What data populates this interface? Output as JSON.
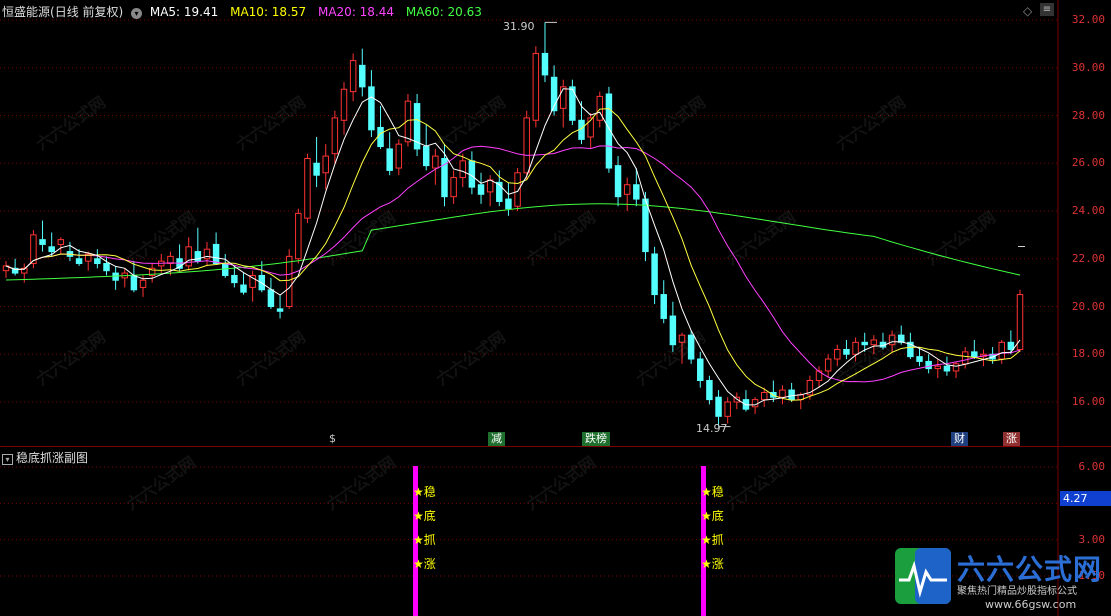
{
  "header": {
    "stock_name": "恒盛能源",
    "period": "(日线 前复权)",
    "ma5": "MA5: 19.41",
    "ma10": "MA10: 18.57",
    "ma20": "MA20: 18.44",
    "ma60": "MA60: 20.63"
  },
  "colors": {
    "up": "#ff3333",
    "down": "#54ffff",
    "ma5": "#ffffff",
    "ma10": "#ffff40",
    "ma20": "#ff40ff",
    "ma60": "#40ff40",
    "grid": "#7a0000",
    "signal_bar": "#ff00ff"
  },
  "price_axis": [
    "32.00",
    "30.00",
    "28.00",
    "26.00",
    "24.00",
    "22.00",
    "20.00",
    "18.00",
    "16.00"
  ],
  "annotations": {
    "high": "31.90",
    "low": "14.97",
    "current_marker": ""
  },
  "event_tags": [
    {
      "label": "$",
      "color": "#ff3333",
      "bg": "transparent"
    },
    {
      "label": "减",
      "color": "#ffffff",
      "bg": "#1f6f2f"
    },
    {
      "label": "跌榜",
      "color": "#ffffff",
      "bg": "#1f6f2f"
    },
    {
      "label": "财",
      "color": "#ffffff",
      "bg": "#1f3f7f"
    },
    {
      "label": "涨",
      "color": "#ffffff",
      "bg": "#8f2f2f"
    }
  ],
  "sub_panel": {
    "title": "稳底抓涨副图",
    "axis": [
      "6.00",
      "4.50",
      "3.00",
      "1.50"
    ],
    "current_value": "4.27",
    "signal_lines": [
      "★稳",
      "★底",
      "★抓",
      "★涨"
    ]
  },
  "watermark": {
    "brand": "六六公式网",
    "slogan": "聚焦热门精品炒股指标公式",
    "url": "www.66gsw.com"
  },
  "toolbar": {
    "diamond_icon": "diamond-icon",
    "menu_icon": "menu-icon",
    "collapse_icon": "chevron-down-icon"
  },
  "chart_data": {
    "type": "candlestick",
    "title": "",
    "ylim": [
      14,
      32.5
    ],
    "candles": [
      [
        21.5,
        21.9,
        21.2,
        21.7
      ],
      [
        21.6,
        22.0,
        21.3,
        21.4
      ],
      [
        21.4,
        21.8,
        21.0,
        21.6
      ],
      [
        21.8,
        23.2,
        21.6,
        23.0
      ],
      [
        22.8,
        23.6,
        22.3,
        22.6
      ],
      [
        22.5,
        23.1,
        22.1,
        22.3
      ],
      [
        22.6,
        22.9,
        22.2,
        22.8
      ],
      [
        22.3,
        22.7,
        21.9,
        22.1
      ],
      [
        22.0,
        22.4,
        21.7,
        21.8
      ],
      [
        21.9,
        22.3,
        21.5,
        22.2
      ],
      [
        22.0,
        22.4,
        21.6,
        21.8
      ],
      [
        21.8,
        22.1,
        21.3,
        21.5
      ],
      [
        21.4,
        21.7,
        20.7,
        21.1
      ],
      [
        21.2,
        21.6,
        20.8,
        21.4
      ],
      [
        21.3,
        21.9,
        20.6,
        20.7
      ],
      [
        20.8,
        21.3,
        20.4,
        21.1
      ],
      [
        21.3,
        21.8,
        21.0,
        21.6
      ],
      [
        21.7,
        22.2,
        21.4,
        21.9
      ],
      [
        21.8,
        22.3,
        21.3,
        22.1
      ],
      [
        22.0,
        22.6,
        21.5,
        21.6
      ],
      [
        21.7,
        22.9,
        21.5,
        22.5
      ],
      [
        22.3,
        23.3,
        21.8,
        21.9
      ],
      [
        22.0,
        22.7,
        21.7,
        22.4
      ],
      [
        22.6,
        23.1,
        21.9,
        21.8
      ],
      [
        21.8,
        22.2,
        21.2,
        21.3
      ],
      [
        21.3,
        21.7,
        20.8,
        21.0
      ],
      [
        20.9,
        21.4,
        20.5,
        20.6
      ],
      [
        20.8,
        21.5,
        20.2,
        21.3
      ],
      [
        21.3,
        21.9,
        20.6,
        20.7
      ],
      [
        20.7,
        21.2,
        19.9,
        20.0
      ],
      [
        19.9,
        20.5,
        19.5,
        19.8
      ],
      [
        20.0,
        22.4,
        19.9,
        22.1
      ],
      [
        22.0,
        24.1,
        21.8,
        23.9
      ],
      [
        23.7,
        26.4,
        23.5,
        26.2
      ],
      [
        26.0,
        27.1,
        25.0,
        25.5
      ],
      [
        25.6,
        26.8,
        24.9,
        26.3
      ],
      [
        26.4,
        28.2,
        26.0,
        27.9
      ],
      [
        27.8,
        29.4,
        27.2,
        29.1
      ],
      [
        29.0,
        30.6,
        28.6,
        30.3
      ],
      [
        30.1,
        30.8,
        28.8,
        29.2
      ],
      [
        29.2,
        29.9,
        27.1,
        27.4
      ],
      [
        27.5,
        28.4,
        26.6,
        26.7
      ],
      [
        26.6,
        27.3,
        25.5,
        25.7
      ],
      [
        25.8,
        27.0,
        25.5,
        26.8
      ],
      [
        26.9,
        28.9,
        26.7,
        28.6
      ],
      [
        28.5,
        28.9,
        26.3,
        26.6
      ],
      [
        26.7,
        27.6,
        25.7,
        25.9
      ],
      [
        25.8,
        26.6,
        25.1,
        26.3
      ],
      [
        26.2,
        26.8,
        24.2,
        24.6
      ],
      [
        24.6,
        25.7,
        24.3,
        25.4
      ],
      [
        25.4,
        26.4,
        25.0,
        26.1
      ],
      [
        26.1,
        26.5,
        24.7,
        25.0
      ],
      [
        25.1,
        25.6,
        24.3,
        24.7
      ],
      [
        24.8,
        25.5,
        24.2,
        25.3
      ],
      [
        25.2,
        25.7,
        24.2,
        24.4
      ],
      [
        24.5,
        25.2,
        23.8,
        24.1
      ],
      [
        24.2,
        25.8,
        24.0,
        25.6
      ],
      [
        25.6,
        28.2,
        25.3,
        27.9
      ],
      [
        27.8,
        30.9,
        27.5,
        30.6
      ],
      [
        30.6,
        31.9,
        29.4,
        29.7
      ],
      [
        29.6,
        30.1,
        28.0,
        28.2
      ],
      [
        28.3,
        29.5,
        27.5,
        29.2
      ],
      [
        29.2,
        29.5,
        27.6,
        27.8
      ],
      [
        27.8,
        28.6,
        26.8,
        27.0
      ],
      [
        27.1,
        28.1,
        26.6,
        27.9
      ],
      [
        27.8,
        29.0,
        27.5,
        28.8
      ],
      [
        28.9,
        29.2,
        25.6,
        25.8
      ],
      [
        25.9,
        26.3,
        24.2,
        24.6
      ],
      [
        24.7,
        25.4,
        24.0,
        25.1
      ],
      [
        25.1,
        25.8,
        24.2,
        24.5
      ],
      [
        24.5,
        24.8,
        21.9,
        22.3
      ],
      [
        22.2,
        22.5,
        20.1,
        20.5
      ],
      [
        20.5,
        21.1,
        19.3,
        19.5
      ],
      [
        19.6,
        20.2,
        18.1,
        18.4
      ],
      [
        18.5,
        18.9,
        17.6,
        18.8
      ],
      [
        18.8,
        19.0,
        17.6,
        17.8
      ],
      [
        17.8,
        18.1,
        16.6,
        16.9
      ],
      [
        16.9,
        17.1,
        15.9,
        16.1
      ],
      [
        16.2,
        16.5,
        14.97,
        15.4
      ],
      [
        15.4,
        16.2,
        15.1,
        16.0
      ],
      [
        16.0,
        16.4,
        15.7,
        16.2
      ],
      [
        16.1,
        16.5,
        15.6,
        15.7
      ],
      [
        15.8,
        16.2,
        15.5,
        16.1
      ],
      [
        16.1,
        16.6,
        15.8,
        16.4
      ],
      [
        16.4,
        16.9,
        16.0,
        16.2
      ],
      [
        16.2,
        16.7,
        15.9,
        16.5
      ],
      [
        16.5,
        16.8,
        16.0,
        16.1
      ],
      [
        16.1,
        16.4,
        15.7,
        16.3
      ],
      [
        16.3,
        17.1,
        16.1,
        16.9
      ],
      [
        16.9,
        17.5,
        16.6,
        17.3
      ],
      [
        17.3,
        18.0,
        17.0,
        17.8
      ],
      [
        17.8,
        18.4,
        17.5,
        18.2
      ],
      [
        18.2,
        18.6,
        17.8,
        18.0
      ],
      [
        18.0,
        18.7,
        17.7,
        18.5
      ],
      [
        18.5,
        18.9,
        18.1,
        18.4
      ],
      [
        18.4,
        18.8,
        18.0,
        18.6
      ],
      [
        18.5,
        18.9,
        18.2,
        18.3
      ],
      [
        18.4,
        19.0,
        18.1,
        18.8
      ],
      [
        18.8,
        19.2,
        18.4,
        18.5
      ],
      [
        18.5,
        18.9,
        17.8,
        17.9
      ],
      [
        17.9,
        18.3,
        17.5,
        17.7
      ],
      [
        17.7,
        18.0,
        17.2,
        17.4
      ],
      [
        17.4,
        17.8,
        17.0,
        17.5
      ],
      [
        17.5,
        17.9,
        17.1,
        17.3
      ],
      [
        17.3,
        17.7,
        17.0,
        17.6
      ],
      [
        17.6,
        18.3,
        17.4,
        18.1
      ],
      [
        18.1,
        18.6,
        17.8,
        17.9
      ],
      [
        17.9,
        18.2,
        17.5,
        18.0
      ],
      [
        18.0,
        18.3,
        17.6,
        17.8
      ],
      [
        17.8,
        18.6,
        17.6,
        18.5
      ],
      [
        18.5,
        19.0,
        18.0,
        18.2
      ],
      [
        18.2,
        20.7,
        18.1,
        20.5
      ]
    ],
    "series": [
      {
        "name": "MA5",
        "values_note": "derived"
      },
      {
        "name": "MA10",
        "values_note": "derived"
      },
      {
        "name": "MA20",
        "values_note": "derived"
      },
      {
        "name": "MA60",
        "values_note": "derived"
      }
    ],
    "signal_indices": [
      68,
      118
    ]
  }
}
